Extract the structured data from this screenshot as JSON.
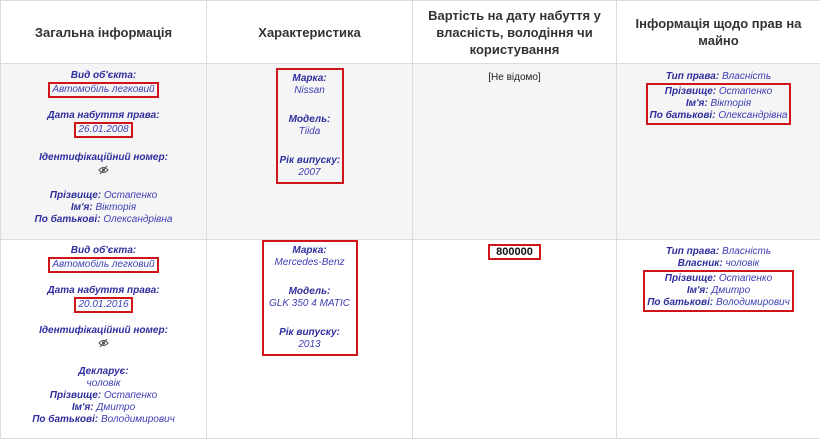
{
  "headers": {
    "general": "Загальна інформація",
    "characteristic": "Характеристика",
    "value": "Вартість на дату набуття у власність, володіння чи користування",
    "rights": "Інформація щодо прав на майно"
  },
  "labels": {
    "object_type": "Вид об'єкта:",
    "acquired": "Дата набуття права:",
    "id_number": "Ідентифікаційний номер:",
    "surname": "Прізвище:",
    "name": "Ім'я:",
    "patronymic": "По батькові:",
    "brand": "Марка:",
    "model": "Модель:",
    "year": "Рік випуску:",
    "right_type": "Тип права:",
    "owner": "Власник:",
    "declarant": "Декларує:"
  },
  "rows": [
    {
      "object_type": "Автомобіль легковий",
      "acquired": "26.01.2008",
      "id_icon": "hidden-eye-icon",
      "surname": "Остапенко",
      "name": "Вікторія",
      "patronymic": "Олександрівна",
      "brand": "Nissan",
      "model": "Tiida",
      "year": "2007",
      "value": "[Не відомо]",
      "right_type": "Власність",
      "r_surname": "Остапенко",
      "r_name": "Вікторія",
      "r_patronymic": "Олександрівна"
    },
    {
      "object_type": "Автомобіль легковий",
      "acquired": "20.01.2016",
      "id_icon": "hidden-eye-icon",
      "declarant": "чоловік",
      "surname": "Остапенко",
      "name": "Дмитро",
      "patronymic": "Володимирович",
      "brand": "Mercedes-Benz",
      "model": "GLK 350 4 MATIC",
      "year": "2013",
      "value": "800000",
      "right_type": "Власність",
      "owner": "чоловік",
      "r_surname": "Остапенко",
      "r_name": "Дмитро",
      "r_patronymic": "Володимирович"
    }
  ],
  "colors": {
    "highlight": "#d0151a",
    "label": "#2e2e9e",
    "value": "#3d3db5"
  }
}
